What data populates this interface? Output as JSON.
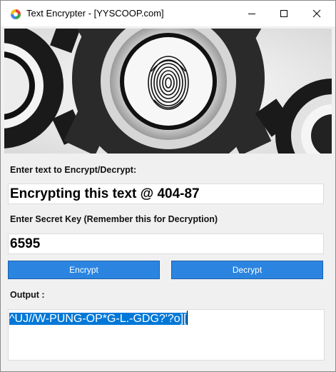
{
  "window": {
    "title": "Text Encrypter - [YYSCOOP.com]",
    "icons": {
      "app": "app-logo-icon",
      "minimize": "minimize-icon",
      "maximize": "maximize-icon",
      "close": "close-icon"
    }
  },
  "banner": {
    "image": "fingerprint-gears-image"
  },
  "form": {
    "input_label": "Enter text to Encrypt/Decrypt:",
    "input_value": "Encrypting this text @ 404-87",
    "key_label": "Enter Secret Key (Remember this for Decryption)",
    "key_value": "6595",
    "encrypt_label": "Encrypt",
    "decrypt_label": "Decrypt",
    "output_label": "Output :",
    "output_value": "^UJ//W-PUNG-OP*G-L.-GDG?'?o]["
  },
  "colors": {
    "button_bg": "#2b85e0",
    "selection_bg": "#0078d7",
    "window_bg": "#f0f0f0"
  }
}
